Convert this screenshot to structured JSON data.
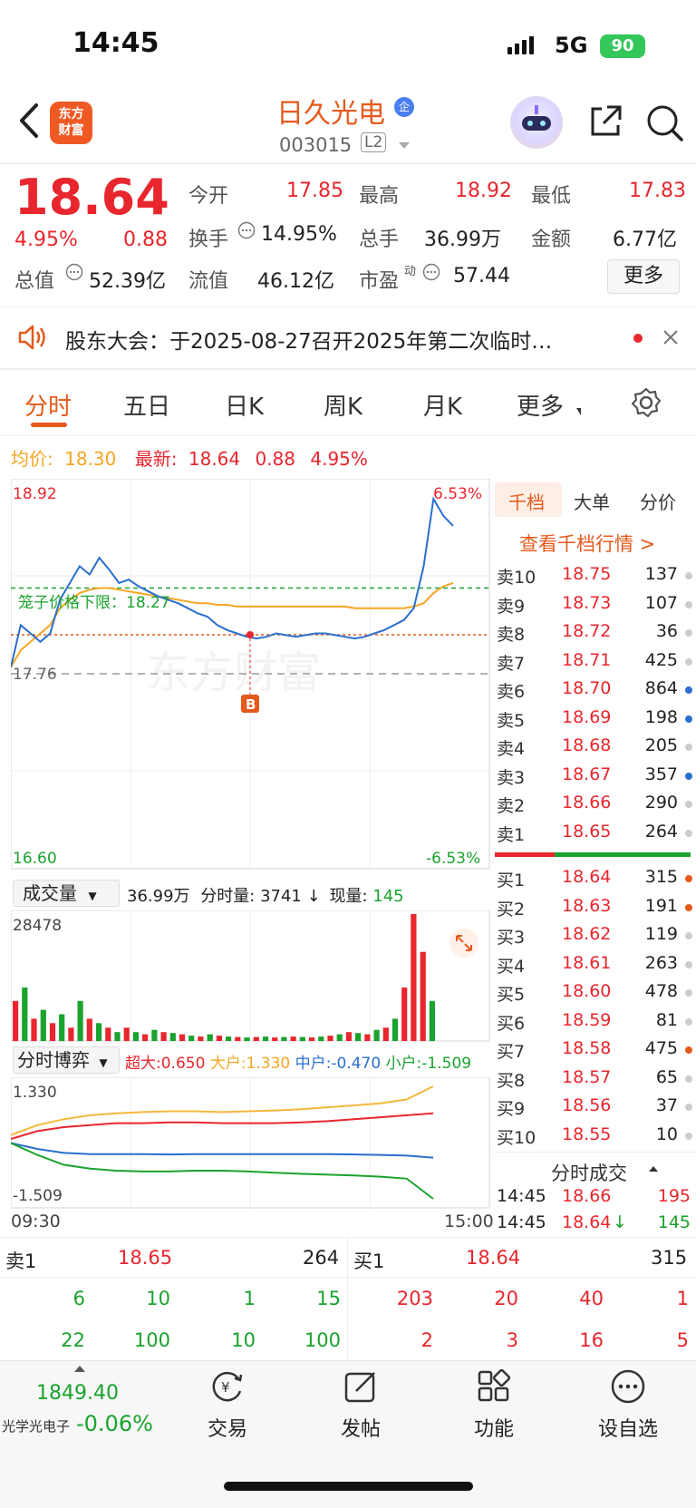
{
  "status_bar": {
    "time": "14:45",
    "network": "5G",
    "battery": "90"
  },
  "header": {
    "stock_name": "日久光电",
    "badge": "企",
    "code": "003015",
    "level": "L2"
  },
  "quote": {
    "price": "18.64",
    "change_pct": "4.95%",
    "change": "0.88",
    "open_label": "今开",
    "open": "17.85",
    "high_label": "最高",
    "high": "18.92",
    "low_label": "最低",
    "low": "17.83",
    "turnover_label": "换手",
    "turnover": "14.95%",
    "volume_label": "总手",
    "volume": "36.99万",
    "amount_label": "金额",
    "amount": "6.77亿",
    "mktcap_label": "总值",
    "mktcap": "52.39亿",
    "float_label": "流值",
    "float": "46.12亿",
    "pe_label": "市盈",
    "pe_sup": "动",
    "pe": "57.44",
    "more": "更多"
  },
  "notice": {
    "text": "股东大会：于2025-08-27召开2025年第二次临时…"
  },
  "tabs": [
    "分时",
    "五日",
    "日K",
    "周K",
    "月K",
    "更多"
  ],
  "chart_header": {
    "avg_label": "均价:",
    "avg": "18.30",
    "latest_label": "最新:",
    "latest": "18.64",
    "chg": "0.88",
    "pct": "4.95%"
  },
  "chart_labels": {
    "top_price": "18.92",
    "top_pct": "6.53%",
    "bottom_price": "16.60",
    "bottom_pct": "-6.53%",
    "prev_close": "17.76",
    "basket": "笼子价格下限：18.27",
    "marker": "B",
    "watermark": "东方财富"
  },
  "chart_data": [
    {
      "type": "line",
      "title": "分时",
      "x_range": [
        "09:30",
        "15:00"
      ],
      "ylim": [
        16.6,
        18.92
      ],
      "prev_close": 17.76,
      "series": [
        {
          "name": "最新",
          "color": "#2a6fcf",
          "values": [
            17.8,
            18.05,
            18.0,
            17.95,
            18.0,
            18.2,
            18.3,
            18.4,
            18.35,
            18.45,
            18.38,
            18.3,
            18.32,
            18.28,
            18.25,
            18.22,
            18.2,
            18.18,
            18.15,
            18.12,
            18.1,
            18.05,
            18.02,
            18.0,
            17.98,
            17.97,
            17.98,
            18.0,
            17.99,
            17.98,
            17.99,
            18.0,
            18.0,
            17.99,
            17.98,
            17.97,
            17.98,
            18.0,
            18.02,
            18.05,
            18.08,
            18.15,
            18.4,
            18.8,
            18.7,
            18.64
          ]
        },
        {
          "name": "均价",
          "color": "#f5a623",
          "values": [
            17.8,
            17.9,
            17.95,
            18.0,
            18.05,
            18.15,
            18.2,
            18.24,
            18.26,
            18.27,
            18.27,
            18.26,
            18.25,
            18.24,
            18.23,
            18.22,
            18.21,
            18.2,
            18.19,
            18.18,
            18.18,
            18.17,
            18.17,
            18.16,
            18.16,
            18.16,
            18.16,
            18.16,
            18.16,
            18.16,
            18.16,
            18.16,
            18.16,
            18.16,
            18.16,
            18.15,
            18.15,
            18.15,
            18.15,
            18.15,
            18.15,
            18.16,
            18.18,
            18.24,
            18.28,
            18.3
          ]
        }
      ]
    },
    {
      "type": "bar",
      "title": "成交量",
      "ylim": [
        0,
        28478
      ],
      "values": [
        9000,
        12000,
        5000,
        7000,
        4000,
        6000,
        3000,
        9000,
        5000,
        4000,
        3000,
        2000,
        3000,
        2000,
        1500,
        2500,
        2000,
        1800,
        1500,
        1200,
        1000,
        1500,
        1200,
        1000,
        900,
        800,
        900,
        1000,
        800,
        900,
        1000,
        900,
        800,
        1000,
        1200,
        1500,
        2000,
        1800,
        1500,
        2500,
        3000,
        5000,
        12000,
        28478,
        20000,
        9000
      ],
      "colors": [
        "r",
        "g",
        "r",
        "g",
        "r",
        "g",
        "r",
        "g",
        "r",
        "g",
        "r",
        "g",
        "r",
        "g",
        "r",
        "g",
        "r",
        "g",
        "r",
        "g",
        "r",
        "g",
        "r",
        "g",
        "r",
        "g",
        "r",
        "g",
        "r",
        "g",
        "r",
        "g",
        "r",
        "g",
        "r",
        "g",
        "r",
        "g",
        "r",
        "g",
        "r",
        "g",
        "r",
        "r",
        "r",
        "g"
      ]
    },
    {
      "type": "line",
      "title": "分时博弈",
      "ylim": [
        -1.509,
        1.33
      ],
      "series": [
        {
          "name": "超大",
          "color": "#e8262d",
          "values": [
            0.0,
            0.2,
            0.3,
            0.35,
            0.4,
            0.4,
            0.42,
            0.42,
            0.4,
            0.4,
            0.4,
            0.42,
            0.45,
            0.5,
            0.55,
            0.6,
            0.65
          ]
        },
        {
          "name": "大户",
          "color": "#f5b73b",
          "values": [
            0.1,
            0.35,
            0.5,
            0.6,
            0.65,
            0.68,
            0.7,
            0.7,
            0.68,
            0.7,
            0.72,
            0.75,
            0.8,
            0.85,
            0.9,
            1.0,
            1.33
          ]
        },
        {
          "name": "中户",
          "color": "#2a6fcf",
          "values": [
            -0.1,
            -0.25,
            -0.35,
            -0.38,
            -0.38,
            -0.38,
            -0.39,
            -0.38,
            -0.38,
            -0.38,
            -0.38,
            -0.38,
            -0.38,
            -0.39,
            -0.4,
            -0.42,
            -0.47
          ]
        },
        {
          "name": "小户",
          "color": "#1aa32e",
          "values": [
            -0.1,
            -0.4,
            -0.65,
            -0.75,
            -0.8,
            -0.82,
            -0.82,
            -0.8,
            -0.8,
            -0.82,
            -0.85,
            -0.88,
            -0.9,
            -0.92,
            -0.95,
            -1.0,
            -1.509
          ]
        }
      ]
    }
  ],
  "volume_panel": {
    "select": "成交量",
    "total": "36.99万",
    "fenshi_label": "分时量:",
    "fenshi": "3741",
    "arrow": "↓",
    "now_label": "现量:",
    "now": "145",
    "max": "28478"
  },
  "game_panel": {
    "select": "分时博弈",
    "chaoda": "超大:0.650",
    "dahu": "大户:1.330",
    "zhonghu": "中户:-0.470",
    "xiaohu": "小户:-1.509",
    "max": "1.330",
    "min": "-1.509",
    "time_start": "09:30",
    "time_end": "15:00"
  },
  "orderbook": {
    "tabs": [
      "千档",
      "大单",
      "分价"
    ],
    "link": "查看千档行情 >",
    "sells": [
      {
        "label": "卖10",
        "price": "18.75",
        "vol": "137",
        "dot": "#cccccc"
      },
      {
        "label": "卖9",
        "price": "18.73",
        "vol": "107",
        "dot": "#cccccc"
      },
      {
        "label": "卖8",
        "price": "18.72",
        "vol": "36",
        "dot": "#cccccc"
      },
      {
        "label": "卖7",
        "price": "18.71",
        "vol": "425",
        "dot": "#cccccc"
      },
      {
        "label": "卖6",
        "price": "18.70",
        "vol": "864",
        "dot": "#2a6fcf"
      },
      {
        "label": "卖5",
        "price": "18.69",
        "vol": "198",
        "dot": "#2a6fcf"
      },
      {
        "label": "卖4",
        "price": "18.68",
        "vol": "205",
        "dot": "#cccccc"
      },
      {
        "label": "卖3",
        "price": "18.67",
        "vol": "357",
        "dot": "#2a6fcf"
      },
      {
        "label": "卖2",
        "price": "18.66",
        "vol": "290",
        "dot": "#cccccc"
      },
      {
        "label": "卖1",
        "price": "18.65",
        "vol": "264",
        "dot": "#cccccc"
      }
    ],
    "buys": [
      {
        "label": "买1",
        "price": "18.64",
        "vol": "315",
        "dot": "#e55a1c"
      },
      {
        "label": "买2",
        "price": "18.63",
        "vol": "191",
        "dot": "#e55a1c"
      },
      {
        "label": "买3",
        "price": "18.62",
        "vol": "119",
        "dot": "#cccccc"
      },
      {
        "label": "买4",
        "price": "18.61",
        "vol": "263",
        "dot": "#cccccc"
      },
      {
        "label": "买5",
        "price": "18.60",
        "vol": "478",
        "dot": "#cccccc"
      },
      {
        "label": "买6",
        "price": "18.59",
        "vol": "81",
        "dot": "#cccccc"
      },
      {
        "label": "买7",
        "price": "18.58",
        "vol": "475",
        "dot": "#e55a1c"
      },
      {
        "label": "买8",
        "price": "18.57",
        "vol": "65",
        "dot": "#cccccc"
      },
      {
        "label": "买9",
        "price": "18.56",
        "vol": "37",
        "dot": "#cccccc"
      },
      {
        "label": "买10",
        "price": "18.55",
        "vol": "10",
        "dot": "#cccccc"
      }
    ],
    "trades_title": "分时成交",
    "trades": [
      {
        "time": "14:45",
        "price": "18.66",
        "vol": "195",
        "arrow": ""
      },
      {
        "time": "14:45",
        "price": "18.64",
        "vol": "145",
        "arrow": "↓"
      }
    ]
  },
  "bottom_book": {
    "sell1_label": "卖1",
    "sell1_price": "18.65",
    "sell1_vol": "264",
    "buy1_label": "买1",
    "buy1_price": "18.64",
    "buy1_vol": "315",
    "sell_row1": [
      "6",
      "10",
      "1",
      "15"
    ],
    "sell_row2": [
      "22",
      "100",
      "10",
      "100"
    ],
    "buy_row1": [
      "203",
      "20",
      "40",
      "1"
    ],
    "buy_row2": [
      "2",
      "3",
      "16",
      "5"
    ]
  },
  "bottom_nav": {
    "index_value": "1849.40",
    "index_name": "光学光电子",
    "index_pct": "-0.06%",
    "trade": "交易",
    "post": "发帖",
    "function": "功能",
    "watchlist": "设自选"
  }
}
